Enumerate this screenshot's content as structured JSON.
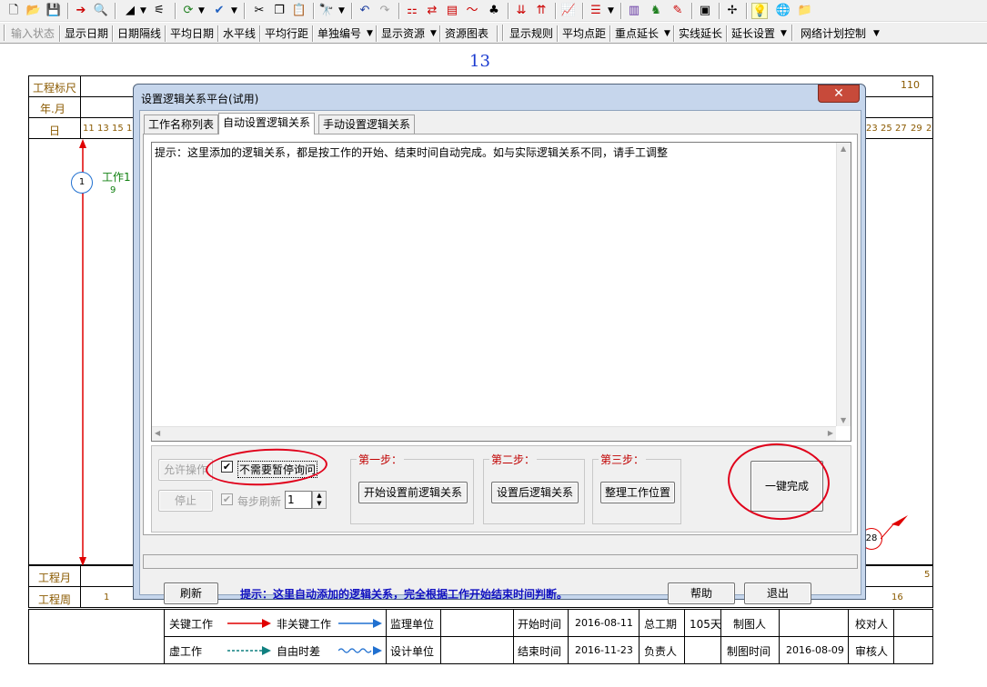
{
  "toolbar2": {
    "items": [
      "输入状态",
      "显示日期",
      "日期隔线",
      "平均日期",
      "水平线",
      "平均行距",
      "单独编号",
      "显示资源",
      "资源图表",
      "显示规则",
      "平均点距",
      "重点延长",
      "实线延长",
      "延长设置",
      "网络计划控制"
    ]
  },
  "doc": {
    "page_number": "13",
    "ruler_labels": [
      "工程标尺",
      "年.月",
      "日"
    ],
    "ruler_end_value": "110",
    "days_left": [
      "11",
      "13",
      "15",
      "1"
    ],
    "days_right": [
      "23",
      "25",
      "27",
      "29",
      "2"
    ],
    "node1": "1",
    "task1_name": "工作1",
    "task1_duration": "9",
    "node28": "28",
    "bottom_labels": [
      "工程月",
      "工程周"
    ],
    "week_first": "1",
    "week_last": "16",
    "month_last": "5"
  },
  "legend": {
    "critical": "关键工作",
    "noncritical": "非关键工作",
    "dummy": "虚工作",
    "free_float": "自由时差",
    "supervisor_label": "监理单位",
    "design_label": "设计单位",
    "start_label": "开始时间",
    "start_value": "2016-08-11",
    "end_label": "结束时间",
    "end_value": "2016-11-23",
    "duration_label": "总工期",
    "duration_value": "105天",
    "owner_label": "负责人",
    "drafter_label": "制图人",
    "draft_time_label": "制图时间",
    "draft_time_value": "2016-08-09",
    "checker_label": "校对人",
    "reviewer_label": "审核人"
  },
  "dialog": {
    "title": "设置逻辑关系平台(试用)",
    "tabs": [
      "工作名称列表",
      "自动设置逻辑关系",
      "手动设置逻辑关系"
    ],
    "text_content": "提示：这里添加的逻辑关系，都是按工作的开始、结束时间自动完成。如与实际逻辑关系不同，请手工调整",
    "allow_op": "允许操作",
    "no_pause": "不需要暂停询问",
    "stop": "停止",
    "step_refresh": "每步刷新",
    "step_value": "1",
    "step1_title": "第一步：",
    "step1_button": "开始设置前逻辑关系",
    "step2_title": "第二步：",
    "step2_button": "设置后逻辑关系",
    "step3_title": "第三步：",
    "step3_button": "整理工作位置",
    "one_click": "一键完成",
    "refresh": "刷新",
    "hint": "提示：这里自动添加的逻辑关系，完全根据工作开始结束时间判断。",
    "help": "帮助",
    "exit": "退出"
  }
}
